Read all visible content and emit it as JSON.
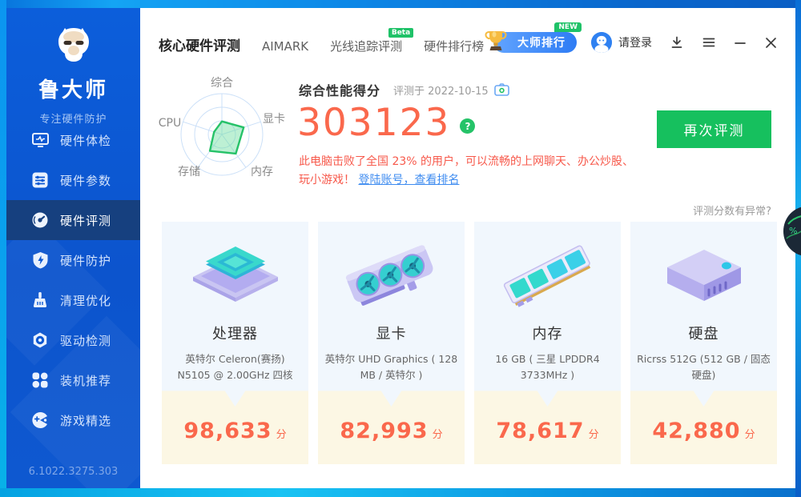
{
  "colors": {
    "accent_orange": "#fa684c",
    "accent_green": "#16c05e",
    "accent_blue": "#2e7cf4",
    "sidebar_blue": "#0c55cf",
    "selected_navy": "#16407f"
  },
  "sidebar": {
    "logo_title": "鲁大师",
    "logo_subtitle": "专注硬件防护",
    "items": [
      {
        "label": "硬件体检",
        "icon": "monitor-pulse-icon",
        "selected": false
      },
      {
        "label": "硬件参数",
        "icon": "sliders-icon",
        "selected": false
      },
      {
        "label": "硬件评测",
        "icon": "gauge-icon",
        "selected": true
      },
      {
        "label": "硬件防护",
        "icon": "shield-bolt-icon",
        "selected": false
      },
      {
        "label": "清理优化",
        "icon": "broom-icon",
        "selected": false
      },
      {
        "label": "驱动检测",
        "icon": "nut-icon",
        "selected": false
      },
      {
        "label": "装机推荐",
        "icon": "four-petals-icon",
        "selected": false
      },
      {
        "label": "游戏精选",
        "icon": "pacman-icon",
        "selected": false
      }
    ],
    "version": "6.1022.3275.303"
  },
  "header": {
    "tabs": [
      {
        "label": "核心硬件评测",
        "active": true
      },
      {
        "label": "AIMARK",
        "active": false
      },
      {
        "label": "光线追踪评测",
        "badge": "Beta",
        "active": false
      },
      {
        "label": "硬件排行榜",
        "active": false
      }
    ],
    "ranking_badge": {
      "label": "大师排行",
      "tag": "NEW"
    },
    "login_label": "请登录"
  },
  "summary": {
    "radar": {
      "labels": [
        "综合",
        "显卡",
        "内存",
        "存储",
        "CPU"
      ],
      "values": [
        0.32,
        0.56,
        0.58,
        0.5,
        0.2
      ]
    },
    "title": "综合性能得分",
    "tested_on": "评测于 2022-10-15",
    "score": "303123",
    "help_glyph": "?",
    "desc_line1": "此电脑击败了全国 23% 的用户，可以流畅的上网聊天、办公炒股、",
    "desc_line2": "玩小游戏！",
    "desc_link": "登陆账号，查看排名",
    "retest_button": "再次评测",
    "anomaly_link": "评测分数有异常?"
  },
  "cards": [
    {
      "title": "处理器",
      "subtitle": "英特尔 Celeron(赛扬) N5105 @ 2.00GHz 四核",
      "score": "98,633",
      "unit": "分",
      "icon": "cpu-illustration"
    },
    {
      "title": "显卡",
      "subtitle": "英特尔 UHD Graphics ( 128 MB / 英特尔 )",
      "score": "82,993",
      "unit": "分",
      "icon": "gpu-illustration"
    },
    {
      "title": "内存",
      "subtitle": "16 GB ( 三星 LPDDR4 3733MHz )",
      "score": "78,617",
      "unit": "分",
      "icon": "ram-illustration"
    },
    {
      "title": "硬盘",
      "subtitle": "Ricrss 512G (512 GB / 固态硬盘)",
      "score": "42,880",
      "unit": "分",
      "icon": "ssd-illustration"
    }
  ],
  "overlay": {
    "percent_label": "%"
  }
}
